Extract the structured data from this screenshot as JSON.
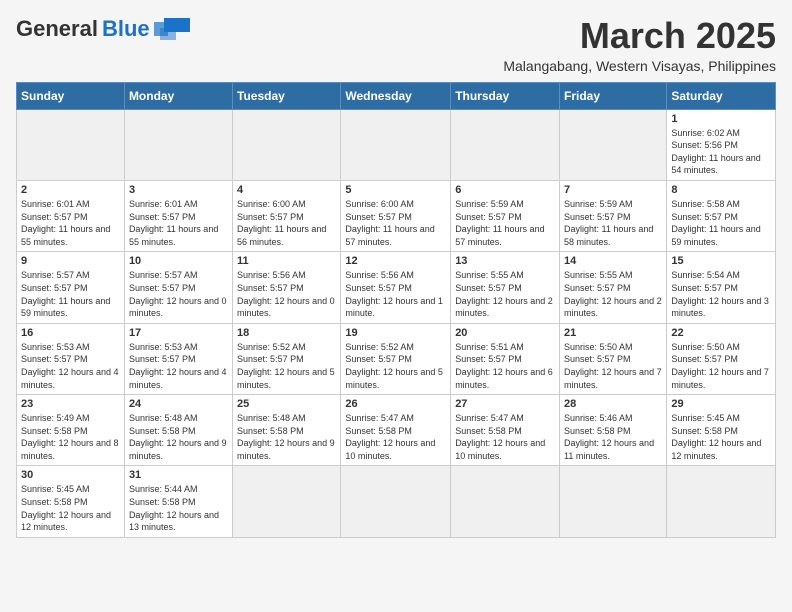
{
  "logo": {
    "general": "General",
    "blue": "Blue"
  },
  "header": {
    "month_year": "March 2025",
    "location": "Malangabang, Western Visayas, Philippines"
  },
  "weekdays": [
    "Sunday",
    "Monday",
    "Tuesday",
    "Wednesday",
    "Thursday",
    "Friday",
    "Saturday"
  ],
  "weeks": [
    [
      {
        "day": "",
        "empty": true
      },
      {
        "day": "",
        "empty": true
      },
      {
        "day": "",
        "empty": true
      },
      {
        "day": "",
        "empty": true
      },
      {
        "day": "",
        "empty": true
      },
      {
        "day": "",
        "empty": true
      },
      {
        "day": "1",
        "sunrise": "6:02 AM",
        "sunset": "5:56 PM",
        "daylight": "11 hours and 54 minutes."
      }
    ],
    [
      {
        "day": "2",
        "sunrise": "6:01 AM",
        "sunset": "5:57 PM",
        "daylight": "11 hours and 55 minutes."
      },
      {
        "day": "3",
        "sunrise": "6:01 AM",
        "sunset": "5:57 PM",
        "daylight": "11 hours and 55 minutes."
      },
      {
        "day": "4",
        "sunrise": "6:00 AM",
        "sunset": "5:57 PM",
        "daylight": "11 hours and 56 minutes."
      },
      {
        "day": "5",
        "sunrise": "6:00 AM",
        "sunset": "5:57 PM",
        "daylight": "11 hours and 57 minutes."
      },
      {
        "day": "6",
        "sunrise": "5:59 AM",
        "sunset": "5:57 PM",
        "daylight": "11 hours and 57 minutes."
      },
      {
        "day": "7",
        "sunrise": "5:59 AM",
        "sunset": "5:57 PM",
        "daylight": "11 hours and 58 minutes."
      },
      {
        "day": "8",
        "sunrise": "5:58 AM",
        "sunset": "5:57 PM",
        "daylight": "11 hours and 59 minutes."
      }
    ],
    [
      {
        "day": "9",
        "sunrise": "5:57 AM",
        "sunset": "5:57 PM",
        "daylight": "11 hours and 59 minutes."
      },
      {
        "day": "10",
        "sunrise": "5:57 AM",
        "sunset": "5:57 PM",
        "daylight": "12 hours and 0 minutes."
      },
      {
        "day": "11",
        "sunrise": "5:56 AM",
        "sunset": "5:57 PM",
        "daylight": "12 hours and 0 minutes."
      },
      {
        "day": "12",
        "sunrise": "5:56 AM",
        "sunset": "5:57 PM",
        "daylight": "12 hours and 1 minute."
      },
      {
        "day": "13",
        "sunrise": "5:55 AM",
        "sunset": "5:57 PM",
        "daylight": "12 hours and 2 minutes."
      },
      {
        "day": "14",
        "sunrise": "5:55 AM",
        "sunset": "5:57 PM",
        "daylight": "12 hours and 2 minutes."
      },
      {
        "day": "15",
        "sunrise": "5:54 AM",
        "sunset": "5:57 PM",
        "daylight": "12 hours and 3 minutes."
      }
    ],
    [
      {
        "day": "16",
        "sunrise": "5:53 AM",
        "sunset": "5:57 PM",
        "daylight": "12 hours and 4 minutes."
      },
      {
        "day": "17",
        "sunrise": "5:53 AM",
        "sunset": "5:57 PM",
        "daylight": "12 hours and 4 minutes."
      },
      {
        "day": "18",
        "sunrise": "5:52 AM",
        "sunset": "5:57 PM",
        "daylight": "12 hours and 5 minutes."
      },
      {
        "day": "19",
        "sunrise": "5:52 AM",
        "sunset": "5:57 PM",
        "daylight": "12 hours and 5 minutes."
      },
      {
        "day": "20",
        "sunrise": "5:51 AM",
        "sunset": "5:57 PM",
        "daylight": "12 hours and 6 minutes."
      },
      {
        "day": "21",
        "sunrise": "5:50 AM",
        "sunset": "5:57 PM",
        "daylight": "12 hours and 7 minutes."
      },
      {
        "day": "22",
        "sunrise": "5:50 AM",
        "sunset": "5:57 PM",
        "daylight": "12 hours and 7 minutes."
      }
    ],
    [
      {
        "day": "23",
        "sunrise": "5:49 AM",
        "sunset": "5:58 PM",
        "daylight": "12 hours and 8 minutes."
      },
      {
        "day": "24",
        "sunrise": "5:48 AM",
        "sunset": "5:58 PM",
        "daylight": "12 hours and 9 minutes."
      },
      {
        "day": "25",
        "sunrise": "5:48 AM",
        "sunset": "5:58 PM",
        "daylight": "12 hours and 9 minutes."
      },
      {
        "day": "26",
        "sunrise": "5:47 AM",
        "sunset": "5:58 PM",
        "daylight": "12 hours and 10 minutes."
      },
      {
        "day": "27",
        "sunrise": "5:47 AM",
        "sunset": "5:58 PM",
        "daylight": "12 hours and 10 minutes."
      },
      {
        "day": "28",
        "sunrise": "5:46 AM",
        "sunset": "5:58 PM",
        "daylight": "12 hours and 11 minutes."
      },
      {
        "day": "29",
        "sunrise": "5:45 AM",
        "sunset": "5:58 PM",
        "daylight": "12 hours and 12 minutes."
      }
    ],
    [
      {
        "day": "30",
        "sunrise": "5:45 AM",
        "sunset": "5:58 PM",
        "daylight": "12 hours and 12 minutes."
      },
      {
        "day": "31",
        "sunrise": "5:44 AM",
        "sunset": "5:58 PM",
        "daylight": "12 hours and 13 minutes."
      },
      {
        "day": "",
        "empty": true
      },
      {
        "day": "",
        "empty": true
      },
      {
        "day": "",
        "empty": true
      },
      {
        "day": "",
        "empty": true
      },
      {
        "day": "",
        "empty": true
      }
    ]
  ]
}
